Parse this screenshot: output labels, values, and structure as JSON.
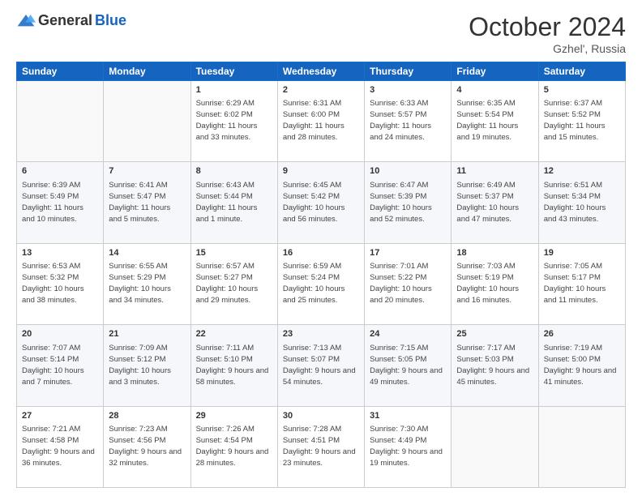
{
  "header": {
    "logo_general": "General",
    "logo_blue": "Blue",
    "month": "October 2024",
    "location": "Gzhel', Russia"
  },
  "weekdays": [
    "Sunday",
    "Monday",
    "Tuesday",
    "Wednesday",
    "Thursday",
    "Friday",
    "Saturday"
  ],
  "weeks": [
    [
      {
        "day": "",
        "info": ""
      },
      {
        "day": "",
        "info": ""
      },
      {
        "day": "1",
        "info": "Sunrise: 6:29 AM\nSunset: 6:02 PM\nDaylight: 11 hours and 33 minutes."
      },
      {
        "day": "2",
        "info": "Sunrise: 6:31 AM\nSunset: 6:00 PM\nDaylight: 11 hours and 28 minutes."
      },
      {
        "day": "3",
        "info": "Sunrise: 6:33 AM\nSunset: 5:57 PM\nDaylight: 11 hours and 24 minutes."
      },
      {
        "day": "4",
        "info": "Sunrise: 6:35 AM\nSunset: 5:54 PM\nDaylight: 11 hours and 19 minutes."
      },
      {
        "day": "5",
        "info": "Sunrise: 6:37 AM\nSunset: 5:52 PM\nDaylight: 11 hours and 15 minutes."
      }
    ],
    [
      {
        "day": "6",
        "info": "Sunrise: 6:39 AM\nSunset: 5:49 PM\nDaylight: 11 hours and 10 minutes."
      },
      {
        "day": "7",
        "info": "Sunrise: 6:41 AM\nSunset: 5:47 PM\nDaylight: 11 hours and 5 minutes."
      },
      {
        "day": "8",
        "info": "Sunrise: 6:43 AM\nSunset: 5:44 PM\nDaylight: 11 hours and 1 minute."
      },
      {
        "day": "9",
        "info": "Sunrise: 6:45 AM\nSunset: 5:42 PM\nDaylight: 10 hours and 56 minutes."
      },
      {
        "day": "10",
        "info": "Sunrise: 6:47 AM\nSunset: 5:39 PM\nDaylight: 10 hours and 52 minutes."
      },
      {
        "day": "11",
        "info": "Sunrise: 6:49 AM\nSunset: 5:37 PM\nDaylight: 10 hours and 47 minutes."
      },
      {
        "day": "12",
        "info": "Sunrise: 6:51 AM\nSunset: 5:34 PM\nDaylight: 10 hours and 43 minutes."
      }
    ],
    [
      {
        "day": "13",
        "info": "Sunrise: 6:53 AM\nSunset: 5:32 PM\nDaylight: 10 hours and 38 minutes."
      },
      {
        "day": "14",
        "info": "Sunrise: 6:55 AM\nSunset: 5:29 PM\nDaylight: 10 hours and 34 minutes."
      },
      {
        "day": "15",
        "info": "Sunrise: 6:57 AM\nSunset: 5:27 PM\nDaylight: 10 hours and 29 minutes."
      },
      {
        "day": "16",
        "info": "Sunrise: 6:59 AM\nSunset: 5:24 PM\nDaylight: 10 hours and 25 minutes."
      },
      {
        "day": "17",
        "info": "Sunrise: 7:01 AM\nSunset: 5:22 PM\nDaylight: 10 hours and 20 minutes."
      },
      {
        "day": "18",
        "info": "Sunrise: 7:03 AM\nSunset: 5:19 PM\nDaylight: 10 hours and 16 minutes."
      },
      {
        "day": "19",
        "info": "Sunrise: 7:05 AM\nSunset: 5:17 PM\nDaylight: 10 hours and 11 minutes."
      }
    ],
    [
      {
        "day": "20",
        "info": "Sunrise: 7:07 AM\nSunset: 5:14 PM\nDaylight: 10 hours and 7 minutes."
      },
      {
        "day": "21",
        "info": "Sunrise: 7:09 AM\nSunset: 5:12 PM\nDaylight: 10 hours and 3 minutes."
      },
      {
        "day": "22",
        "info": "Sunrise: 7:11 AM\nSunset: 5:10 PM\nDaylight: 9 hours and 58 minutes."
      },
      {
        "day": "23",
        "info": "Sunrise: 7:13 AM\nSunset: 5:07 PM\nDaylight: 9 hours and 54 minutes."
      },
      {
        "day": "24",
        "info": "Sunrise: 7:15 AM\nSunset: 5:05 PM\nDaylight: 9 hours and 49 minutes."
      },
      {
        "day": "25",
        "info": "Sunrise: 7:17 AM\nSunset: 5:03 PM\nDaylight: 9 hours and 45 minutes."
      },
      {
        "day": "26",
        "info": "Sunrise: 7:19 AM\nSunset: 5:00 PM\nDaylight: 9 hours and 41 minutes."
      }
    ],
    [
      {
        "day": "27",
        "info": "Sunrise: 7:21 AM\nSunset: 4:58 PM\nDaylight: 9 hours and 36 minutes."
      },
      {
        "day": "28",
        "info": "Sunrise: 7:23 AM\nSunset: 4:56 PM\nDaylight: 9 hours and 32 minutes."
      },
      {
        "day": "29",
        "info": "Sunrise: 7:26 AM\nSunset: 4:54 PM\nDaylight: 9 hours and 28 minutes."
      },
      {
        "day": "30",
        "info": "Sunrise: 7:28 AM\nSunset: 4:51 PM\nDaylight: 9 hours and 23 minutes."
      },
      {
        "day": "31",
        "info": "Sunrise: 7:30 AM\nSunset: 4:49 PM\nDaylight: 9 hours and 19 minutes."
      },
      {
        "day": "",
        "info": ""
      },
      {
        "day": "",
        "info": ""
      }
    ]
  ]
}
